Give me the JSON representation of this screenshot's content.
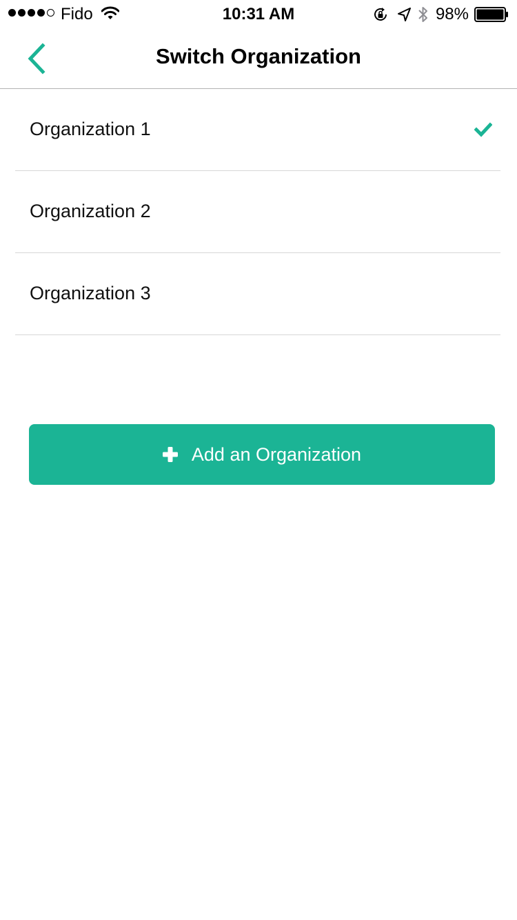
{
  "status_bar": {
    "carrier": "Fido",
    "time": "10:31 AM",
    "battery_percent": "98%",
    "signal_bars": 4,
    "signal_max": 5,
    "icons": [
      "wifi-icon",
      "orientation-lock-icon",
      "location-arrow-icon",
      "bluetooth-icon",
      "battery-icon"
    ]
  },
  "nav": {
    "title": "Switch Organization",
    "back_icon": "chevron-left-icon"
  },
  "organizations": [
    {
      "label": "Organization 1",
      "selected": true
    },
    {
      "label": "Organization 2",
      "selected": false
    },
    {
      "label": "Organization 3",
      "selected": false
    }
  ],
  "add_button": {
    "label": "Add an Organization",
    "icon": "plus-icon"
  },
  "colors": {
    "accent": "#1bb495",
    "separator": "#d6d6d6",
    "nav_border": "#b2b2b2",
    "text": "#111111"
  }
}
